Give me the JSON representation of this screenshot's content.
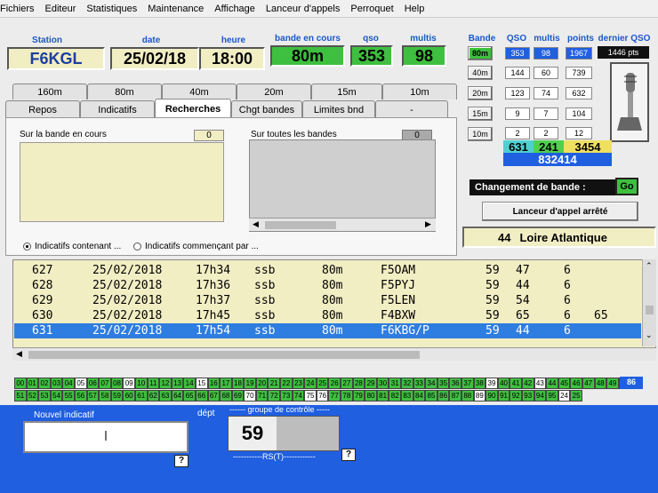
{
  "menu": [
    "Fichiers",
    "Editeur",
    "Statistiques",
    "Maintenance",
    "Affichage",
    "Lanceur d'appels",
    "Perroquet",
    "Help"
  ],
  "header": {
    "station_label": "Station",
    "station": "F6KGL",
    "date_label": "date",
    "date": "25/02/18",
    "heure_label": "heure",
    "heure": "18:00",
    "bande_label": "bande en cours",
    "bande": "80m",
    "qso_label": "qso",
    "qso": "353",
    "multis_label": "multis",
    "multis": "98"
  },
  "bands_table": {
    "col_labels": [
      "Bande",
      "QSO",
      "multis",
      "points",
      "dernier QSO"
    ],
    "rows": [
      {
        "band": "80m",
        "qso": "353",
        "multis": "98",
        "points": "1967",
        "active": true
      },
      {
        "band": "40m",
        "qso": "144",
        "multis": "60",
        "points": "739",
        "active": false
      },
      {
        "band": "20m",
        "qso": "123",
        "multis": "74",
        "points": "632",
        "active": false
      },
      {
        "band": "15m",
        "qso": "9",
        "multis": "7",
        "points": "104",
        "active": false
      },
      {
        "band": "10m",
        "qso": "2",
        "multis": "2",
        "points": "12",
        "active": false
      }
    ],
    "last_qso": "1446 pts",
    "totals": {
      "qso": "631",
      "multis": "241",
      "points": "3454"
    },
    "score": "832414"
  },
  "change_band": {
    "label": "Changement de bande :",
    "go": "Go"
  },
  "launcher_status": "Lanceur d'appel arrêté",
  "dept": {
    "number": "44",
    "name": "Loire Atlantique"
  },
  "band_tabs": [
    "160m",
    "80m",
    "40m",
    "20m",
    "15m",
    "10m"
  ],
  "func_tabs": [
    "Repos",
    "Indicatifs",
    "Recherches",
    "Chgt bandes",
    "Limites bnd",
    "-"
  ],
  "active_tab": "Recherches",
  "search": {
    "left_label": "Sur la bande en cours",
    "left_count": "0",
    "right_label": "Sur toutes les bandes",
    "right_count": "0",
    "radio1": "Indicatifs contenant ...",
    "radio2": "Indicatifs commençant par ..."
  },
  "log": [
    {
      "num": "627",
      "date": "25/02/2018",
      "time": "17h34",
      "mode": "ssb",
      "band": "80m",
      "call": "F5OAM",
      "rst": "59",
      "rcv": "47",
      "dept": "6",
      "extra": "",
      "selected": false
    },
    {
      "num": "628",
      "date": "25/02/2018",
      "time": "17h36",
      "mode": "ssb",
      "band": "80m",
      "call": "F5PYJ",
      "rst": "59",
      "rcv": "44",
      "dept": "6",
      "extra": "",
      "selected": false
    },
    {
      "num": "629",
      "date": "25/02/2018",
      "time": "17h37",
      "mode": "ssb",
      "band": "80m",
      "call": "F5LEN",
      "rst": "59",
      "rcv": "54",
      "dept": "6",
      "extra": "",
      "selected": false
    },
    {
      "num": "630",
      "date": "25/02/2018",
      "time": "17h45",
      "mode": "ssb",
      "band": "80m",
      "call": "F4BXW",
      "rst": "59",
      "rcv": "65",
      "dept": "6",
      "extra": "65",
      "selected": false
    },
    {
      "num": "631",
      "date": "25/02/2018",
      "time": "17h54",
      "mode": "ssb",
      "band": "80m",
      "call": "F6KBG/P",
      "rst": "59",
      "rcv": "44",
      "dept": "6",
      "extra": "",
      "selected": true
    }
  ],
  "multis_grid": {
    "row1": [
      "00",
      "01",
      "02",
      "03",
      "04",
      "05",
      "06",
      "07",
      "08",
      "09",
      "10",
      "11",
      "12",
      "13",
      "14",
      "15",
      "16",
      "17",
      "18",
      "19",
      "20",
      "21",
      "22",
      "23",
      "24",
      "25",
      "26",
      "27",
      "28",
      "29",
      "30",
      "31",
      "32",
      "33",
      "34",
      "35",
      "36",
      "37",
      "38",
      "39",
      "40",
      "41",
      "42",
      "43",
      "44",
      "45",
      "46",
      "47",
      "48",
      "49",
      "50"
    ],
    "row1_white": [
      "05",
      "09",
      "15",
      "39",
      "43",
      "50"
    ],
    "row2": [
      "51",
      "52",
      "53",
      "54",
      "55",
      "56",
      "57",
      "58",
      "59",
      "60",
      "61",
      "62",
      "63",
      "64",
      "65",
      "66",
      "67",
      "68",
      "69",
      "70",
      "71",
      "72",
      "73",
      "74",
      "75",
      "76",
      "77",
      "78",
      "79",
      "80",
      "81",
      "82",
      "83",
      "84",
      "85",
      "86",
      "87",
      "88",
      "89",
      "90",
      "91",
      "92",
      "93",
      "94",
      "95",
      "24",
      "25"
    ],
    "row2_white": [
      "70",
      "75",
      "76",
      "89",
      "24"
    ],
    "count": "86"
  },
  "entry": {
    "new_call_label": "Nouvel indicatif",
    "dept_label": "dépt",
    "control_label": "------ groupe de contrôle -----",
    "rs_value": "59",
    "rst_label": "-----------RS(T)------------",
    "help": "?"
  },
  "colors": {
    "accent_blue": "#1f5fe0",
    "green": "#3fbf3f",
    "cream": "#f2eec4",
    "selected_row": "#2e7de0"
  }
}
